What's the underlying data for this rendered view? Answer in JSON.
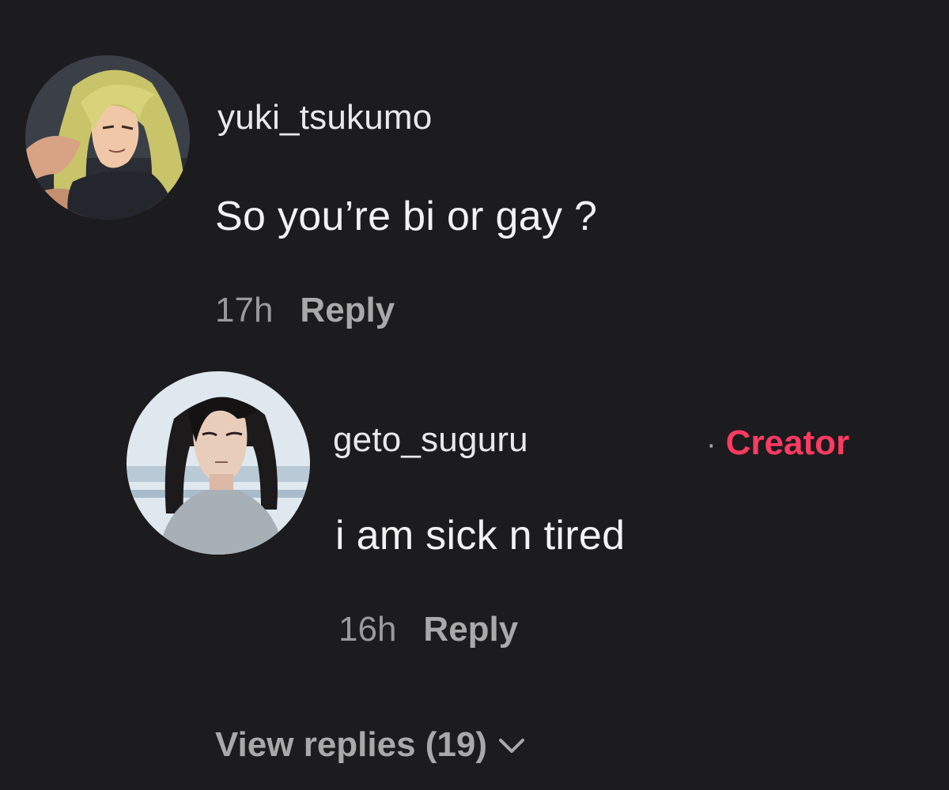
{
  "comments": [
    {
      "username": "yuki_tsukumo",
      "text": "So you’re bi or gay ?",
      "time": "17h",
      "reply_label": "Reply"
    },
    {
      "username": "geto_suguru",
      "badge_separator": "·",
      "badge": "Creator",
      "text": "i am sick n tired",
      "time": "16h",
      "reply_label": "Reply"
    }
  ],
  "view_replies": {
    "label": "View replies (19)",
    "icon": "chevron-down-icon"
  },
  "colors": {
    "background": "#1c1b1d",
    "username": "#e9e9e9",
    "body_text": "#f2f2f2",
    "meta": "#9a9a9a",
    "creator_badge": "#ff3a63"
  }
}
